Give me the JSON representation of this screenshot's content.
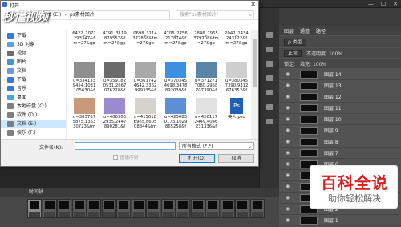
{
  "dialog": {
    "title": "打开",
    "close_glyph": "✕",
    "address_root": "文档 (E:)",
    "address_sep": "›",
    "address_folder": "ps素材图片",
    "search_placeholder": "搜索\"ps素材图片\"",
    "nav_items": [
      {
        "label": "下载",
        "color": "#3b78d8"
      },
      {
        "label": "3D 对象",
        "color": "#5aa0e6"
      },
      {
        "label": "视频",
        "color": "#6c6c6c"
      },
      {
        "label": "图片",
        "color": "#4a8fd8"
      },
      {
        "label": "文档",
        "color": "#6b9bd8"
      },
      {
        "label": "下载",
        "color": "#3b78d8"
      },
      {
        "label": "音乐",
        "color": "#3b78d8"
      },
      {
        "label": "桌面",
        "color": "#4aa3e8"
      },
      {
        "label": "本地磁盘 (C:)",
        "color": "#7f7f7f"
      },
      {
        "label": "软件 (D:)",
        "color": "#7f7f7f"
      },
      {
        "label": "文档 (E:)",
        "color": "#7f7f7f",
        "selected": true
      },
      {
        "label": "娱乐 (F:)",
        "color": "#7f7f7f"
      }
    ],
    "files": [
      {
        "name": "6422_1071\n293347&f\nm=27&gp",
        "thumb": "none"
      },
      {
        "name": "4791_3119\n879557&f\nm=27&gp",
        "thumb": "none"
      },
      {
        "name": "0698_3114\n377868&fm\n=27&gp",
        "thumb": "none"
      },
      {
        "name": "4706_2756\n217874&f\nm=27&gp",
        "thumb": "none"
      },
      {
        "name": "2846_7965\n379708&fm\n=27&gp",
        "thumb": "none"
      },
      {
        "name": "2042_1434\n243122&f\nm=27&gp",
        "thumb": "none"
      },
      {
        "name": "u=334133\n9454,1031\n105630&f",
        "thumb": "#8f8f8f"
      },
      {
        "name": "u=359182\n0531,2667\n076228&f",
        "thumb": "#6b6b6b"
      },
      {
        "name": "u=361742\n4642,3362\n999335&f",
        "thumb": "#a9a9a9"
      },
      {
        "name": "u=370345\n4698,3478\n892039&f",
        "thumb": "#3d8fe0"
      },
      {
        "name": "u=371271\n7080,2958\n707390&f",
        "thumb": "#5a84a8"
      },
      {
        "name": "u=380345\n7390,9312\n676352&f",
        "thumb": "#cfcfcf"
      },
      {
        "name": "u=383767\n5875,1353\n30723&fm\n=27&gp",
        "thumb": "#c99a7a"
      },
      {
        "name": "u=406303\n2935,2447\n890281&f",
        "thumb": "#9c8bd0"
      },
      {
        "name": "u=415618\n6965,8605\n08344&fm\n=27&gp",
        "thumb": "#d8d2cc"
      },
      {
        "name": "u=425683\n0173,1029\n865258&f\nm=27&gp",
        "thumb": "#5c8fd6"
      },
      {
        "name": "u=428117\n2449,4046\n231336&f\nm=27&gp",
        "thumb": "#e2e2e2"
      },
      {
        "name": "美人.psd",
        "thumb": "#1f5fb8",
        "badge": "Ps"
      }
    ],
    "filename_label": "文件名(N):",
    "filename_value": "",
    "filetype_value": "所有格式 (*.*)",
    "readonly_label": "图像序列",
    "open_button": "打开(O)",
    "cancel_button": "取消"
  },
  "photoshop": {
    "panel_tabs": [
      "图层",
      "通道",
      "路径"
    ],
    "filter_label": "ρ 类型",
    "blend_mode": "正常",
    "opacity_label": "不透明度: 100%",
    "lock_label": "锁定:",
    "fill_label": "填充: 100%",
    "unify_label": "统一:",
    "propagate_label": "传播帧 1",
    "layers": [
      "图层 14",
      "图层 13",
      "图层 12",
      "图层 11",
      "图层 10",
      "图层 9",
      "图层 8",
      "图层 7",
      "图层 6",
      "图层 5",
      "图层 4",
      "图层 3",
      "图层 2",
      "图层 1"
    ],
    "timeline_title": "时间轴",
    "timeline_meta": "100%    移动",
    "window_controls": [
      "—",
      "☐",
      "✕"
    ]
  },
  "overlays": {
    "watermark": "秒懂视频",
    "badge_title": "百科全说",
    "badge_subtitle": "助你轻松解决"
  }
}
